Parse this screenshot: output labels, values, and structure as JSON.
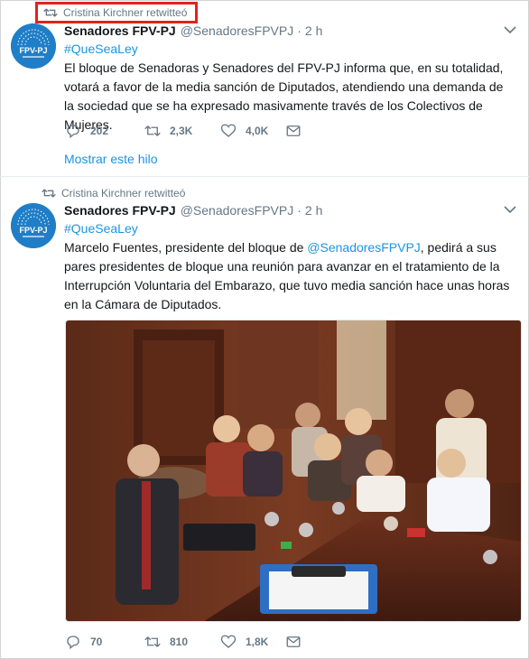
{
  "tweets": [
    {
      "retweet_label": "Cristina Kirchner retwitteó",
      "author_name": "Senadores FPV-PJ",
      "author_handle": "@SenadoresFPVPJ",
      "separator": "·",
      "time": "2 h",
      "avatar_text": "FPV-PJ",
      "hashtag": "#QueSeaLey",
      "text": "El bloque de Senadoras y Senadores del FPV-PJ informa que, en su totalidad, votará a favor de la media sanción de Diputados, atendiendo una demanda de la sociedad que se ha expresado masivamente través de los Colectivos de Mujeres.",
      "replies": "202",
      "retweets": "2,3K",
      "likes": "4,0K",
      "show_thread": "Mostrar este hilo"
    },
    {
      "retweet_label": "Cristina Kirchner retwitteó",
      "author_name": "Senadores FPV-PJ",
      "author_handle": "@SenadoresFPVPJ",
      "separator": "·",
      "time": "2 h",
      "avatar_text": "FPV-PJ",
      "hashtag": "#QueSeaLey",
      "text_before": "Marcelo Fuentes, presidente del bloque de ",
      "mention": "@SenadoresFPVPJ",
      "text_after": ", pedirá a sus pares presidentes de bloque una reunión para avanzar en el tratamiento de la Interrupción Voluntaria del Embarazo, que tuvo media sanción hace unas horas en la Cámara de Diputados.",
      "replies": "70",
      "retweets": "810",
      "likes": "1,8K"
    }
  ],
  "colors": {
    "link": "#1b95e0",
    "muted": "#657786",
    "highlight": "#e0231b",
    "avatar": "#1f7ec7"
  },
  "icons": [
    "retweet-icon",
    "caret-down-icon",
    "reply-icon",
    "like-icon",
    "message-icon"
  ]
}
